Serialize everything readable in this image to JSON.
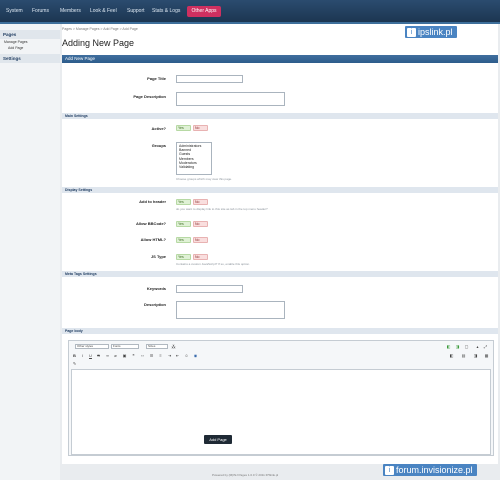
{
  "nav": {
    "items": [
      "System",
      "Forums",
      "Members",
      "Look & Feel",
      "Support",
      "Stats & Logs"
    ],
    "other_apps": "Other Apps"
  },
  "sidebar": {
    "section_pages": "Pages",
    "manage_pages": "Manage Pages",
    "add_page": "Add Page",
    "section_settings": "Settings"
  },
  "breadcrumb": "Pages > Manage Pages > Add Page > Add Page",
  "page_title": "Adding New Page",
  "watermark_top": "ipslink.pl",
  "watermark_bottom": "forum.invisionize.pl",
  "form": {
    "header": "Add New Page",
    "page_title_label": "Page Title",
    "page_description_label": "Page Description",
    "main_settings": "Main Settings",
    "active_label": "Active?",
    "groups_label": "Groups",
    "groups": [
      "Administrators",
      "Banned",
      "Guests",
      "Members",
      "Moderators",
      "Validating"
    ],
    "groups_hint": "Choose groups which may view this page.",
    "display_settings": "Display Settings",
    "add_to_header_label": "Add to header",
    "add_to_header_hint": "do you want to display link to this site as tab in the top menu header?",
    "allow_bbcode_label": "Allow BBCode?",
    "allow_html_label": "Allow HTML?",
    "js_type_label": "JS Type",
    "js_type_hint": "Contains a custom JavaScript? If so, enable this option.",
    "meta_tags_settings": "Meta Tags Settings",
    "keywords_label": "Keywords",
    "description_label": "Description",
    "page_body": "Page body",
    "yes": "Yes",
    "no": "No"
  },
  "editor": {
    "style_select": "Other styles",
    "font_select": "Fonts",
    "size_select": "Sizes"
  },
  "submit_label": "Add Page",
  "footer": "Powered by (M)INJ Pages 1.0.0 © 2011 IPSlink.pl"
}
